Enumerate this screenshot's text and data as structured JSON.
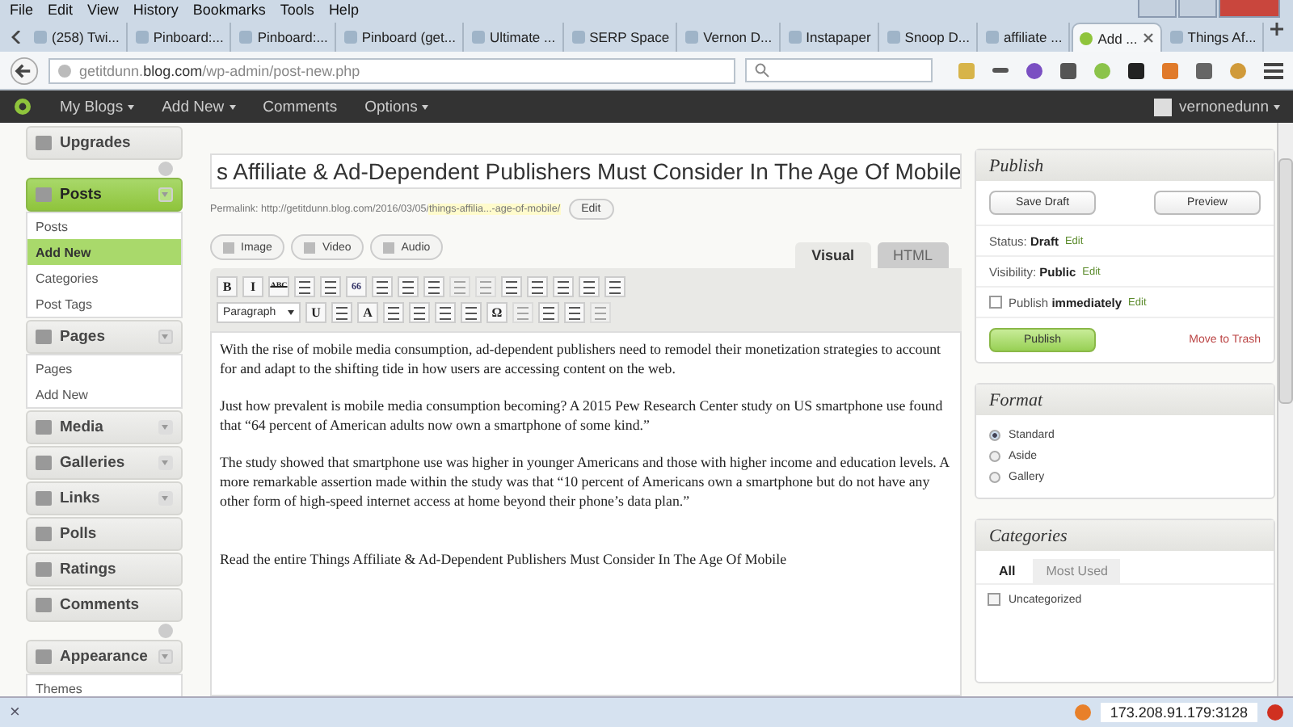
{
  "menu_bar": [
    "File",
    "Edit",
    "View",
    "History",
    "Bookmarks",
    "Tools",
    "Help"
  ],
  "tabs": [
    {
      "title": "(258) Twi...",
      "selected": false
    },
    {
      "title": "Pinboard:...",
      "selected": false
    },
    {
      "title": "Pinboard:...",
      "selected": false
    },
    {
      "title": "Pinboard (get...",
      "selected": false
    },
    {
      "title": "Ultimate ...",
      "selected": false
    },
    {
      "title": "SERP Space",
      "selected": false
    },
    {
      "title": "Vernon D...",
      "selected": false
    },
    {
      "title": "Instapaper",
      "selected": false
    },
    {
      "title": "Snoop D...",
      "selected": false
    },
    {
      "title": "affiliate ...",
      "selected": false
    },
    {
      "title": "Add ...",
      "selected": true
    },
    {
      "title": "Things Af...",
      "selected": false
    }
  ],
  "address": "getitdunn.**blog.com**/wp-admin/post-new.php",
  "admin_bar": {
    "items": [
      {
        "label": "My Blogs",
        "has_menu": true
      },
      {
        "label": "Add New",
        "has_menu": true
      },
      {
        "label": "Comments",
        "has_menu": false
      },
      {
        "label": "Options",
        "has_menu": true
      }
    ],
    "user": "vernonedunn"
  },
  "sidebar": {
    "items": [
      {
        "kind": "menu",
        "label": "Upgrades",
        "has_toggle": false,
        "selected": false
      },
      {
        "kind": "separator"
      },
      {
        "kind": "menu",
        "label": "Posts",
        "has_toggle": true,
        "selected": true,
        "expanded": true,
        "children": [
          {
            "label": "Posts",
            "selected": false
          },
          {
            "label": "Add New",
            "selected": true
          },
          {
            "label": "Categories",
            "selected": false
          },
          {
            "label": "Post Tags",
            "selected": false
          }
        ]
      },
      {
        "kind": "menu",
        "label": "Pages",
        "has_toggle": true,
        "selected": false,
        "expanded": true,
        "children": [
          {
            "label": "Pages",
            "selected": false
          },
          {
            "label": "Add New",
            "selected": false
          }
        ]
      },
      {
        "kind": "menu",
        "label": "Media",
        "has_toggle": true,
        "selected": false,
        "expanded": false
      },
      {
        "kind": "menu",
        "label": "Galleries",
        "has_toggle": true,
        "selected": false,
        "expanded": false
      },
      {
        "kind": "menu",
        "label": "Links",
        "has_toggle": true,
        "selected": false,
        "expanded": false
      },
      {
        "kind": "menu",
        "label": "Polls",
        "has_toggle": false,
        "selected": false
      },
      {
        "kind": "menu",
        "label": "Ratings",
        "has_toggle": false,
        "selected": false
      },
      {
        "kind": "menu",
        "label": "Comments",
        "has_toggle": false,
        "selected": false
      },
      {
        "kind": "separator"
      },
      {
        "kind": "menu",
        "label": "Appearance",
        "has_toggle": true,
        "selected": false,
        "expanded": true,
        "children": [
          {
            "label": "Themes",
            "selected": false
          }
        ]
      }
    ]
  },
  "editor": {
    "title": "s Affiliate & Ad-Dependent Publishers Must Consider In The Age Of Mobile",
    "permalink_label": "Permalink:",
    "permalink_base": "http://getitdunn.blog.com/2016/03/05/",
    "permalink_slug": "things-affilia...-age-of-mobile/",
    "permalink_button": "Edit",
    "media_buttons": [
      "Image",
      "Video",
      "Audio"
    ],
    "tabs": [
      {
        "label": "Visual",
        "selected": true
      },
      {
        "label": "HTML",
        "selected": false
      }
    ],
    "toolbar_1": [
      {
        "kind": "glyph",
        "text": "B",
        "disabled": false
      },
      {
        "kind": "glyph",
        "text": "I",
        "disabled": false
      },
      {
        "kind": "glyph",
        "text": "ABC",
        "disabled": false
      },
      {
        "kind": "icon",
        "disabled": false
      },
      {
        "kind": "icon",
        "disabled": false
      },
      {
        "kind": "glyph",
        "text": "66",
        "disabled": false
      },
      {
        "kind": "icon",
        "disabled": false
      },
      {
        "kind": "icon",
        "disabled": false
      },
      {
        "kind": "icon",
        "disabled": false
      },
      {
        "kind": "icon",
        "disabled": true
      },
      {
        "kind": "icon",
        "disabled": true
      },
      {
        "kind": "icon",
        "disabled": false
      },
      {
        "kind": "icon",
        "disabled": false
      },
      {
        "kind": "icon",
        "disabled": false
      },
      {
        "kind": "icon",
        "disabled": false
      },
      {
        "kind": "icon",
        "disabled": false
      }
    ],
    "format_select": "Paragraph",
    "toolbar_2": [
      {
        "kind": "glyph",
        "text": "U",
        "disabled": false
      },
      {
        "kind": "icon",
        "disabled": false
      },
      {
        "kind": "glyph",
        "text": "A",
        "disabled": false
      },
      {
        "kind": "icon",
        "disabled": false
      },
      {
        "kind": "icon",
        "disabled": false
      },
      {
        "kind": "icon",
        "disabled": false
      },
      {
        "kind": "icon",
        "disabled": false
      },
      {
        "kind": "glyph",
        "text": "Ω",
        "disabled": false
      },
      {
        "kind": "icon",
        "disabled": true
      },
      {
        "kind": "icon",
        "disabled": false
      },
      {
        "kind": "icon",
        "disabled": false
      },
      {
        "kind": "icon",
        "disabled": true
      }
    ],
    "paragraphs": [
      "With the rise of mobile media consumption, ad-dependent publishers need to remodel their monetization strategies to account for and adapt to the shifting tide in how users are accessing content on the web.",
      "Just how prevalent is mobile media consumption becoming? A 2015 Pew Research Center study on US smartphone use found that “64 percent of American adults now own a smartphone of some kind.”",
      "The study showed that smartphone use was higher in younger Americans and those with higher income and education levels. A more remarkable assertion made within the study was that “10 percent of Americans own a smartphone but do not have any other form of high-speed internet access at home beyond their phone’s data plan.”",
      "Read the entire Things Affiliate & Ad-Dependent Publishers Must Consider In The Age Of Mobile"
    ]
  },
  "publish": {
    "title": "Publish",
    "save_draft": "Save Draft",
    "preview": "Preview",
    "rows": [
      {
        "text": "Status: **Draft**",
        "link": "Edit",
        "kind": "plain"
      },
      {
        "text": "Visibility: **Public**",
        "link": "Edit",
        "kind": "plain"
      },
      {
        "text": "Publish **immediately**",
        "link": "Edit",
        "kind": "calendar"
      }
    ],
    "publish_button": "Publish",
    "trash": "Move to Trash"
  },
  "format": {
    "title": "Format",
    "options": [
      {
        "label": "Standard",
        "selected": true
      },
      {
        "label": "Aside",
        "selected": false
      },
      {
        "label": "Gallery",
        "selected": false
      }
    ]
  },
  "categories": {
    "title": "Categories",
    "tabs": [
      {
        "label": "All",
        "selected": true
      },
      {
        "label": "Most Used",
        "selected": false
      }
    ],
    "items": [
      {
        "label": "Uncategorized",
        "checked": false
      }
    ]
  },
  "status_bar": {
    "close": "×",
    "proxy": "173.208.91.179:3128"
  }
}
